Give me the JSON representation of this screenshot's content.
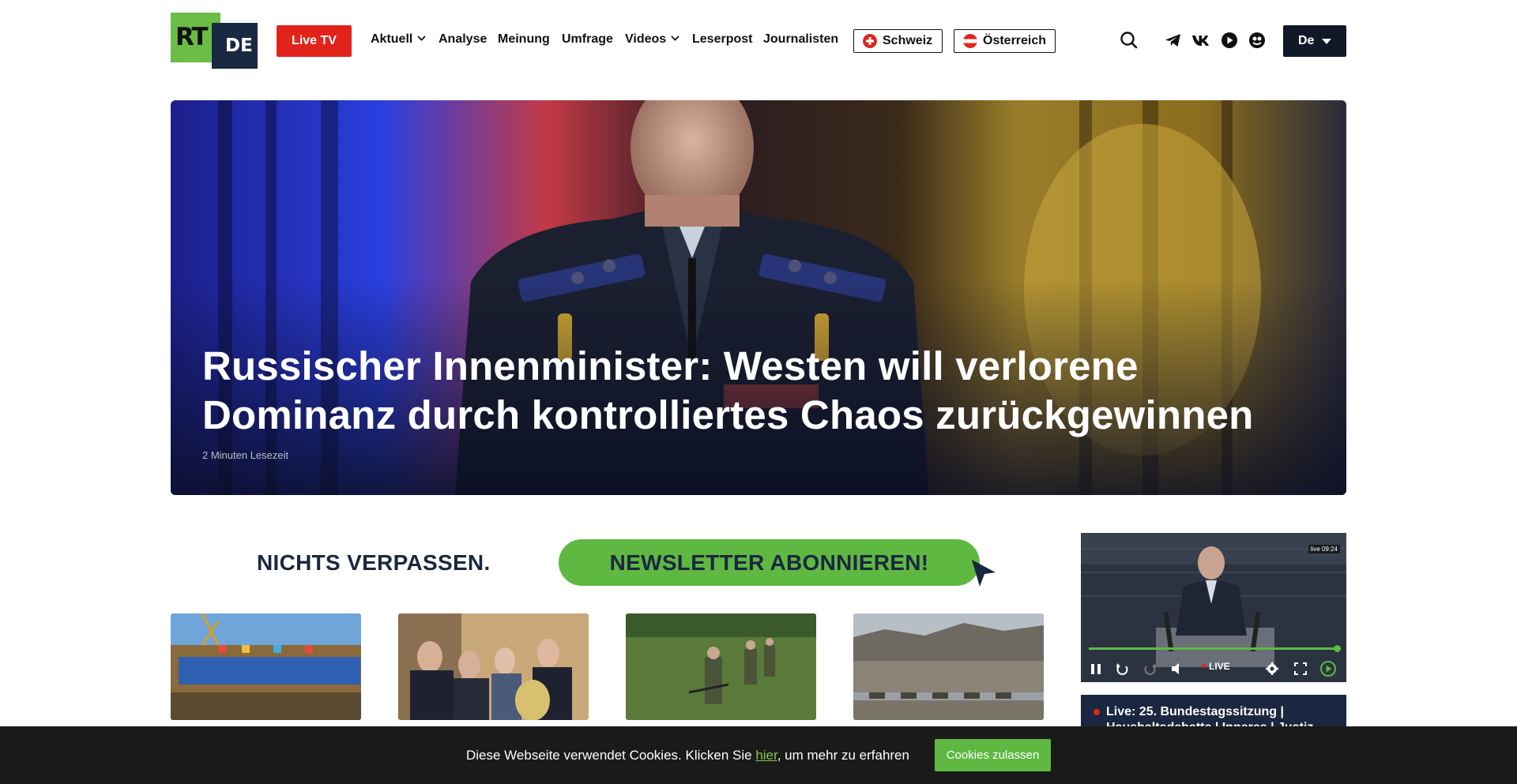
{
  "header": {
    "logo_main": "RT",
    "logo_sub": "DE",
    "live_tv": "Live TV",
    "nav": [
      {
        "label": "Aktuell",
        "dropdown": true
      },
      {
        "label": "Analyse",
        "dropdown": false
      },
      {
        "label": "Meinung",
        "dropdown": false
      },
      {
        "label": "Umfrage",
        "dropdown": false
      },
      {
        "label": "Videos",
        "dropdown": true
      },
      {
        "label": "Leserpost",
        "dropdown": false
      },
      {
        "label": "Journalisten",
        "dropdown": false
      }
    ],
    "countries": [
      "Schweiz",
      "Österreich"
    ],
    "icons": [
      "search-icon",
      "telegram-icon",
      "vk-icon",
      "rumble-icon",
      "odysee-icon"
    ],
    "language": "De"
  },
  "hero": {
    "title": "Russischer Innenminister: Westen will verlorene Dominanz durch kontrolliertes Chaos zurückgewinnen",
    "meta": "2 Minuten Lesezeit"
  },
  "newsletter": {
    "text": "NICHTS VERPASSEN.",
    "button": "NEWSLETTER ABONNIEREN!"
  },
  "player": {
    "live": "LIVE",
    "timecode": "09:24",
    "progress": 1.0
  },
  "live_card": {
    "title": "Live: 25. Bundestagssitzung | Haushaltsdebatte | Inneres | Justiz"
  },
  "cookie": {
    "text_before": "Diese Webseite verwendet Cookies. Klicken Sie ",
    "link": "hier",
    "text_after": ", um mehr zu erfahren",
    "button": "Cookies zulassen"
  },
  "colors": {
    "brand_green": "#6bbd45",
    "live_red": "#e2231a",
    "navy": "#1b2740",
    "accent_green": "#5fb841"
  }
}
